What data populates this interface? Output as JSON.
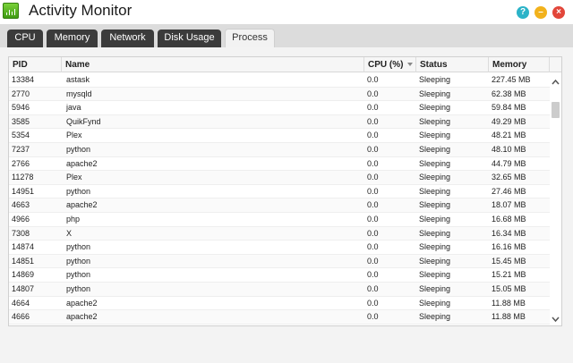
{
  "window": {
    "title": "Activity Monitor",
    "help_label": "?",
    "minimize_label": "–",
    "close_label": "×"
  },
  "tabs": [
    {
      "label": "CPU",
      "active": false
    },
    {
      "label": "Memory",
      "active": false
    },
    {
      "label": "Network",
      "active": false
    },
    {
      "label": "Disk Usage",
      "active": false
    },
    {
      "label": "Process",
      "active": true
    }
  ],
  "table": {
    "columns": {
      "pid": "PID",
      "name": "Name",
      "cpu": "CPU (%)",
      "status": "Status",
      "memory": "Memory"
    },
    "sorted_column": "cpu",
    "rows": [
      {
        "pid": "13384",
        "name": "astask",
        "cpu": "0.0",
        "status": "Sleeping",
        "memory": "227.45 MB"
      },
      {
        "pid": "2770",
        "name": "mysqld",
        "cpu": "0.0",
        "status": "Sleeping",
        "memory": "62.38 MB"
      },
      {
        "pid": "5946",
        "name": "java",
        "cpu": "0.0",
        "status": "Sleeping",
        "memory": "59.84 MB"
      },
      {
        "pid": "3585",
        "name": "QuikFynd",
        "cpu": "0.0",
        "status": "Sleeping",
        "memory": "49.29 MB"
      },
      {
        "pid": "5354",
        "name": "Plex",
        "cpu": "0.0",
        "status": "Sleeping",
        "memory": "48.21 MB"
      },
      {
        "pid": "7237",
        "name": "python",
        "cpu": "0.0",
        "status": "Sleeping",
        "memory": "48.10 MB"
      },
      {
        "pid": "2766",
        "name": "apache2",
        "cpu": "0.0",
        "status": "Sleeping",
        "memory": "44.79 MB"
      },
      {
        "pid": "11278",
        "name": "Plex",
        "cpu": "0.0",
        "status": "Sleeping",
        "memory": "32.65 MB"
      },
      {
        "pid": "14951",
        "name": "python",
        "cpu": "0.0",
        "status": "Sleeping",
        "memory": "27.46 MB"
      },
      {
        "pid": "4663",
        "name": "apache2",
        "cpu": "0.0",
        "status": "Sleeping",
        "memory": "18.07 MB"
      },
      {
        "pid": "4966",
        "name": "php",
        "cpu": "0.0",
        "status": "Sleeping",
        "memory": "16.68 MB"
      },
      {
        "pid": "7308",
        "name": "X",
        "cpu": "0.0",
        "status": "Sleeping",
        "memory": "16.34 MB"
      },
      {
        "pid": "14874",
        "name": "python",
        "cpu": "0.0",
        "status": "Sleeping",
        "memory": "16.16 MB"
      },
      {
        "pid": "14851",
        "name": "python",
        "cpu": "0.0",
        "status": "Sleeping",
        "memory": "15.45 MB"
      },
      {
        "pid": "14869",
        "name": "python",
        "cpu": "0.0",
        "status": "Sleeping",
        "memory": "15.21 MB"
      },
      {
        "pid": "14807",
        "name": "python",
        "cpu": "0.0",
        "status": "Sleeping",
        "memory": "15.05 MB"
      },
      {
        "pid": "4664",
        "name": "apache2",
        "cpu": "0.0",
        "status": "Sleeping",
        "memory": "11.88 MB"
      },
      {
        "pid": "4666",
        "name": "apache2",
        "cpu": "0.0",
        "status": "Sleeping",
        "memory": "11.88 MB"
      }
    ]
  },
  "icons": {
    "app": "activity-monitor-icon",
    "help": "help-icon",
    "minimize": "minimize-icon",
    "close": "close-icon",
    "sort": "sort-descending-icon",
    "scroll_up": "chevron-up-icon",
    "scroll_down": "chevron-down-icon"
  },
  "colors": {
    "help": "#2bb3c8",
    "minimize": "#f2b21c",
    "close": "#e2463a",
    "tab_dark": "#3b3b3b",
    "accent_green": "#5bb82a"
  }
}
